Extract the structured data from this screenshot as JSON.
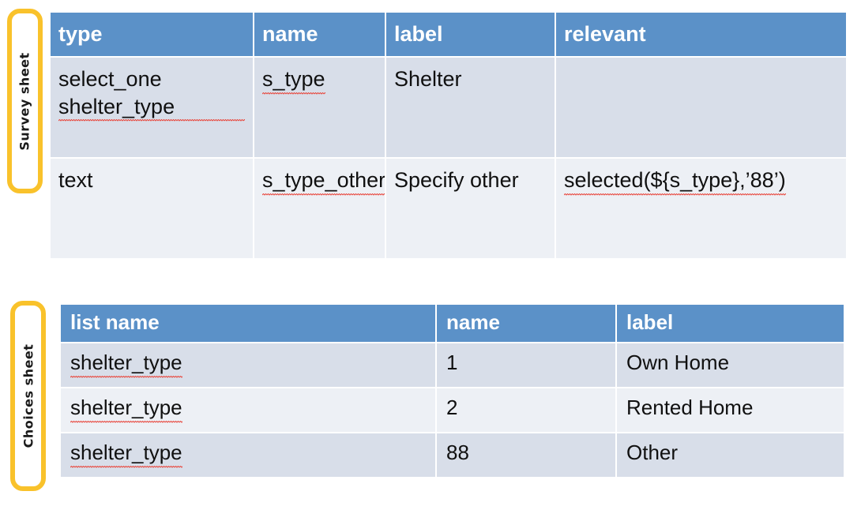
{
  "survey": {
    "tag_label": "Survey sheet",
    "columns": [
      "type",
      "name",
      "label",
      "relevant"
    ],
    "rows": [
      {
        "type": "select_one shelter_type",
        "name": "s_type",
        "label": "Shelter",
        "relevant": ""
      },
      {
        "type": "text",
        "name": "s_type_other",
        "label": "Specify other",
        "relevant": "selected(${s_type},’88’)"
      }
    ]
  },
  "choices": {
    "tag_label": "Choices sheet",
    "columns": [
      "list name",
      "name",
      "label"
    ],
    "rows": [
      {
        "list_name": "shelter_type",
        "name": "1",
        "label": "Own Home"
      },
      {
        "list_name": "shelter_type",
        "name": "2",
        "label": "Rented Home"
      },
      {
        "list_name": "shelter_type",
        "name": "88",
        "label": "Other"
      }
    ]
  },
  "colors": {
    "header_blue": "#5B91C8",
    "row_shade_dark": "#D8DEE9",
    "row_shade_light": "#EDF0F5",
    "tag_border_yellow": "#F9C22B",
    "spellcheck_red": "#E8463C"
  }
}
